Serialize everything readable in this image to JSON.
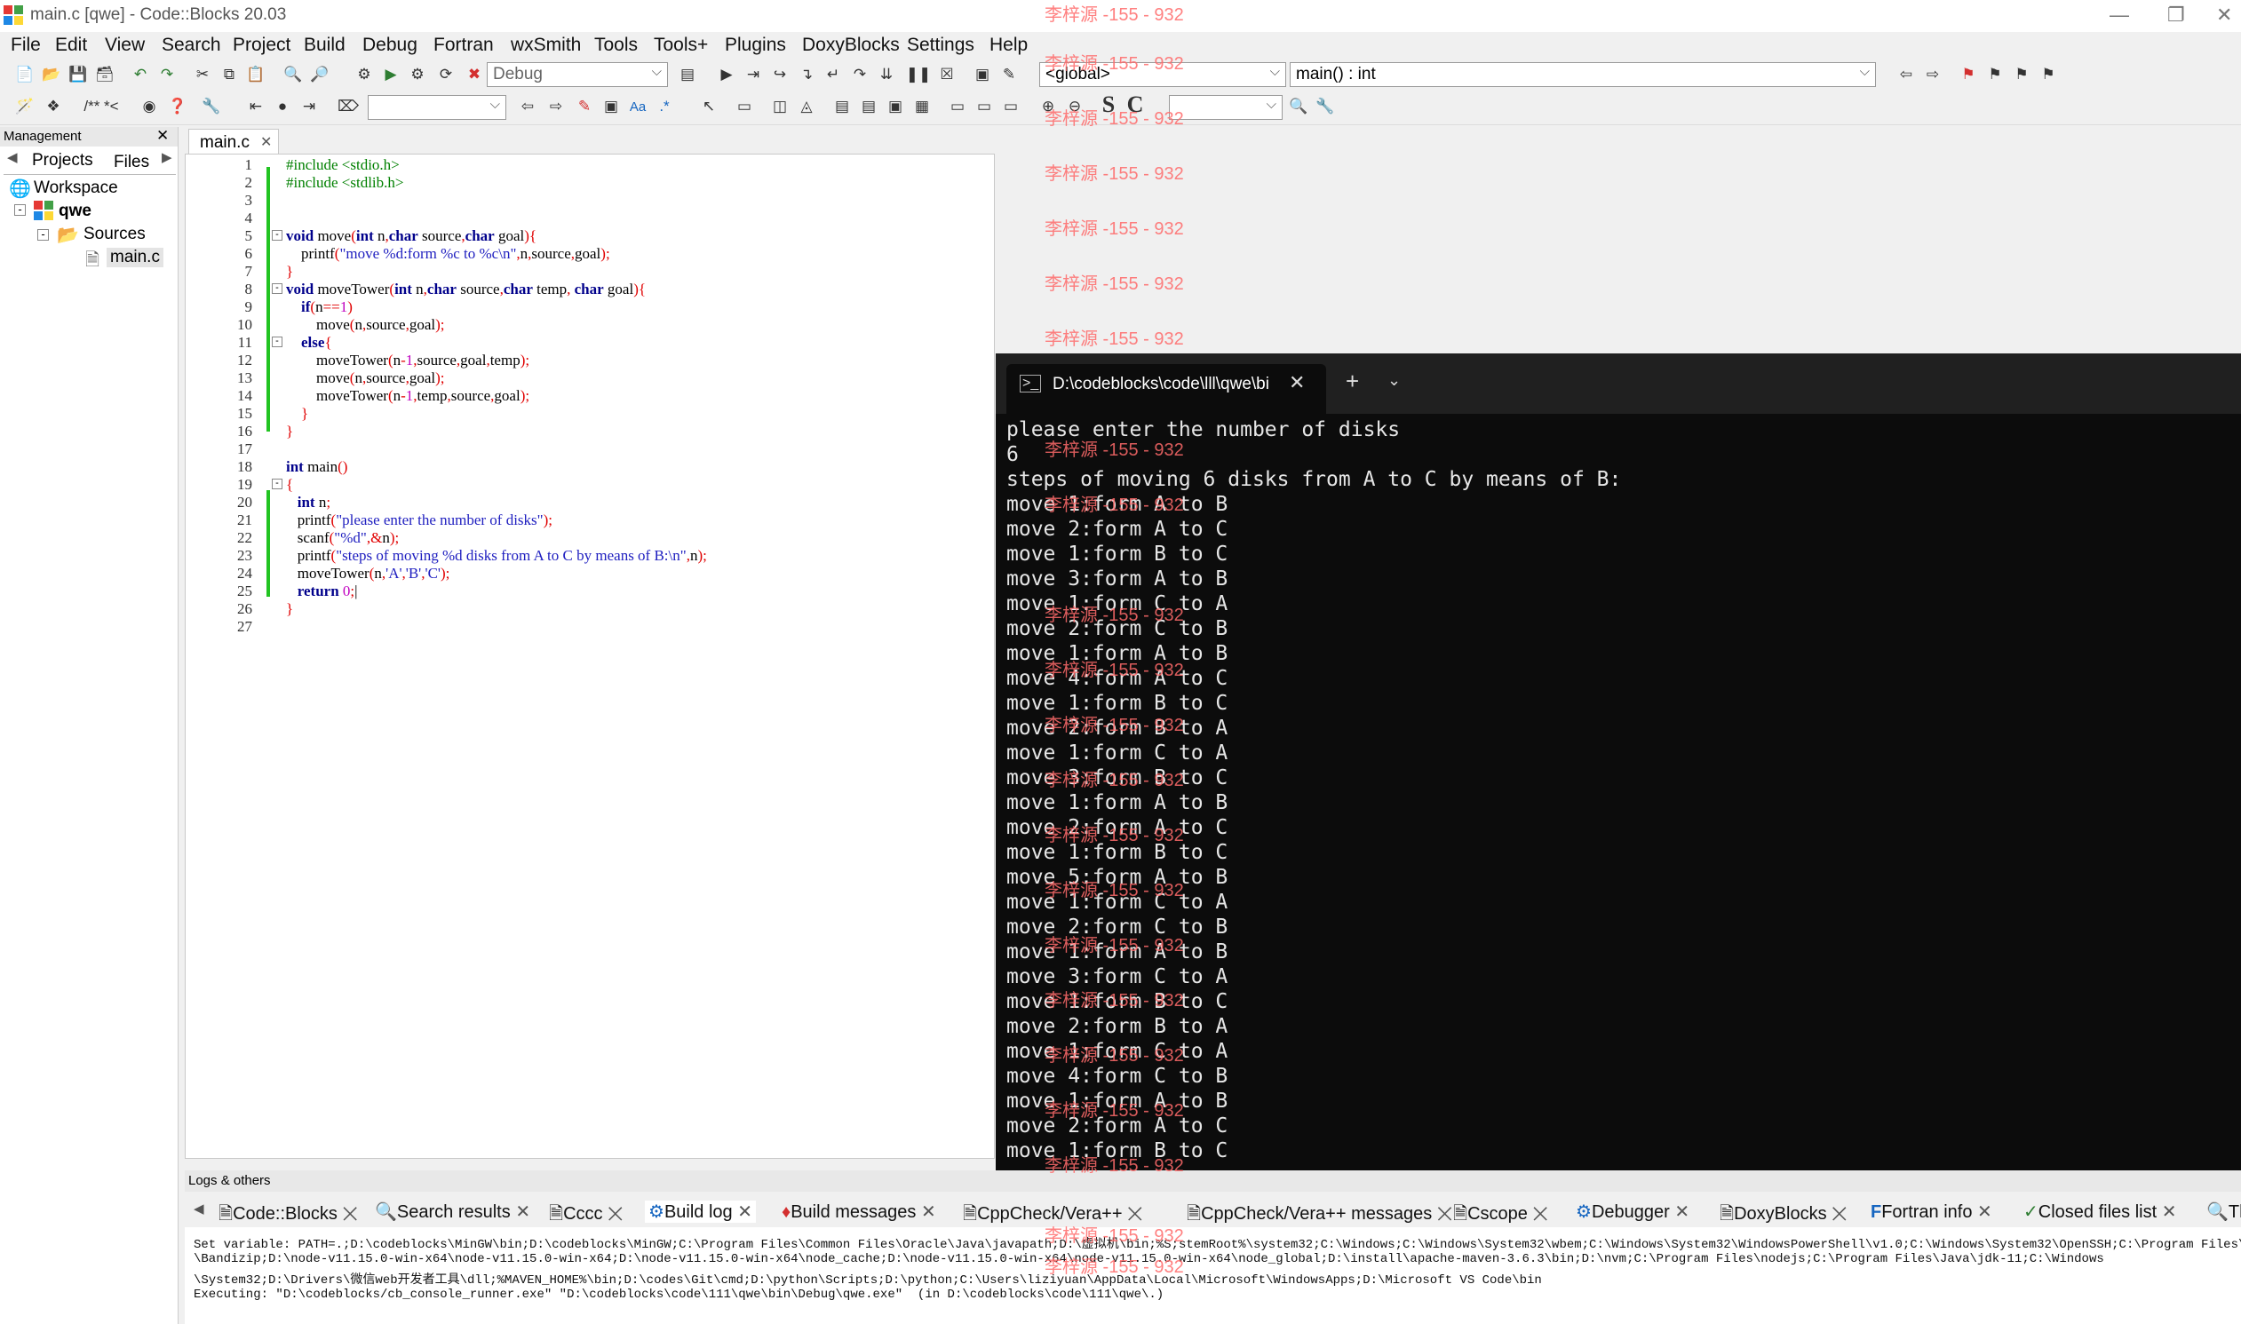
{
  "window": {
    "title": "main.c [qwe] - Code::Blocks 20.03"
  },
  "menu": [
    "File",
    "Edit",
    "View",
    "Search",
    "Project",
    "Build",
    "Debug",
    "Fortran",
    "wxSmith",
    "Tools",
    "Tools+",
    "Plugins",
    "DoxyBlocks",
    "Settings",
    "Help"
  ],
  "toolbar": {
    "build_target": "Debug",
    "scope": "<global>",
    "function": "main() : int",
    "bold_s": "S",
    "bold_c": "C",
    "doc_comment": "/** *<"
  },
  "management": {
    "header": "Management",
    "tabs": [
      "Projects",
      "Files"
    ],
    "workspace": "Workspace",
    "project": "qwe",
    "sources": "Sources",
    "file": "main.c"
  },
  "editor": {
    "tab": "main.c",
    "line_numbers": [
      "1",
      "2",
      "3",
      "4",
      "5",
      "6",
      "7",
      "8",
      "9",
      "10",
      "11",
      "12",
      "13",
      "14",
      "15",
      "16",
      "17",
      "18",
      "19",
      "20",
      "21",
      "22",
      "23",
      "24",
      "25",
      "26",
      "27"
    ]
  },
  "terminal": {
    "tab_title": "D:\\codeblocks\\code\\lll\\qwe\\bi",
    "lines": [
      "please enter the number of disks",
      "6",
      "steps of moving 6 disks from A to C by means of B:",
      "move 1:form A to B",
      "move 2:form A to C",
      "move 1:form B to C",
      "move 3:form A to B",
      "move 1:form C to A",
      "move 2:form C to B",
      "move 1:form A to B",
      "move 4:form A to C",
      "move 1:form B to C",
      "move 2:form B to A",
      "move 1:form C to A",
      "move 3:form B to C",
      "move 1:form A to B",
      "move 2:form A to C",
      "move 1:form B to C",
      "move 5:form A to B",
      "move 1:form C to A",
      "move 2:form C to B",
      "move 1:form A to B",
      "move 3:form C to A",
      "move 1:form B to C",
      "move 2:form B to A",
      "move 1:form C to A",
      "move 4:form C to B",
      "move 1:form A to B",
      "move 2:form A to C",
      "move 1:form B to C"
    ]
  },
  "logs": {
    "header": "Logs & others",
    "tabs": [
      "Code::Blocks",
      "Search results",
      "Cccc",
      "Build log",
      "Build messages",
      "CppCheck/Vera++",
      "CppCheck/Vera++ messages",
      "Cscope",
      "Debugger",
      "DoxyBlocks",
      "Fortran info",
      "Closed files list",
      "Th"
    ],
    "lines": [
      "Set variable: PATH=.;D:\\codeblocks\\MinGW\\bin;D:\\codeblocks\\MinGW;C:\\Program Files\\Common Files\\Oracle\\Java\\javapath;D:\\虚拟机\\bin;%S;stemRoot%\\system32;C:\\Windows;C:\\Windows\\System32\\wbem;C:\\Windows\\System32\\WindowsPowerShell\\v1.0;C:\\Windows\\System32\\OpenSSH;C:\\Program Files\\dotnet;D:",
      "\\Bandizip;D:\\node-v11.15.0-win-x64\\node-v11.15.0-win-x64;D:\\node-v11.15.0-win-x64\\node_cache;D:\\node-v11.15.0-win-x64\\node-v11.15.0-win-x64\\node_global;D:\\install\\apache-maven-3.6.3\\bin;D:\\nvm;C:\\Program Files\\nodejs;C:\\Program Files\\Java\\jdk-11;C:\\Windows",
      "\\System32;D:\\Drivers\\微信web开发者工具\\dll;%MAVEN_HOME%\\bin;D:\\codes\\Git\\cmd;D:\\python\\Scripts;D:\\python;C:\\Users\\liziyuan\\AppData\\Local\\Microsoft\\WindowsApps;D:\\Microsoft VS Code\\bin",
      "Executing: \"D:\\codeblocks/cb_console_runner.exe\" \"D:\\codeblocks\\code\\111\\qwe\\bin\\Debug\\qwe.exe\"  (in D:\\codeblocks\\code\\111\\qwe\\.)"
    ]
  },
  "watermark": "李梓源 -155 - 932"
}
